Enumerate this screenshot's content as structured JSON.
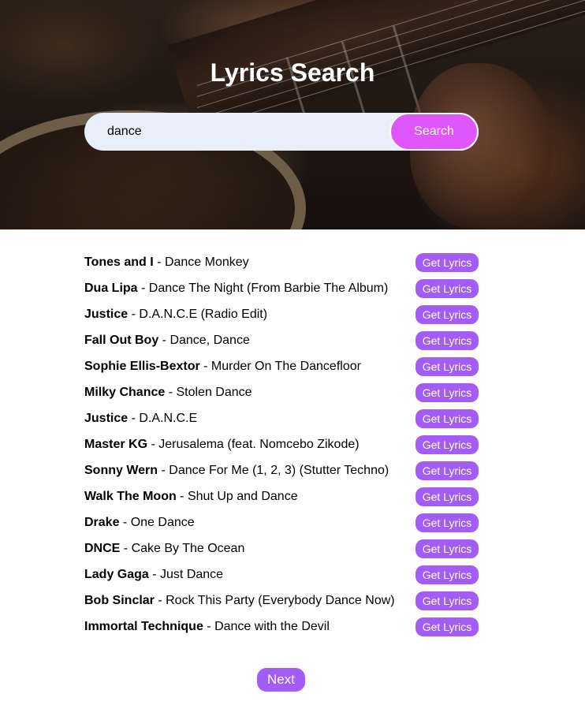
{
  "header": {
    "title": "Lyrics Search"
  },
  "search": {
    "value": "dance",
    "button_label": "Search"
  },
  "results": [
    {
      "artist": "Tones and I",
      "title": "Dance Monkey",
      "button_label": "Get Lyrics"
    },
    {
      "artist": "Dua Lipa",
      "title": "Dance The Night (From Barbie The Album)",
      "button_label": "Get Lyrics"
    },
    {
      "artist": "Justice",
      "title": "D.A.N.C.E (Radio Edit)",
      "button_label": "Get Lyrics"
    },
    {
      "artist": "Fall Out Boy",
      "title": "Dance, Dance",
      "button_label": "Get Lyrics"
    },
    {
      "artist": "Sophie Ellis-Bextor",
      "title": "Murder On The Dancefloor",
      "button_label": "Get Lyrics"
    },
    {
      "artist": "Milky Chance",
      "title": "Stolen Dance",
      "button_label": "Get Lyrics"
    },
    {
      "artist": "Justice",
      "title": "D.A.N.C.E",
      "button_label": "Get Lyrics"
    },
    {
      "artist": "Master KG",
      "title": "Jerusalema (feat. Nomcebo Zikode)",
      "button_label": "Get Lyrics"
    },
    {
      "artist": "Sonny Wern",
      "title": "Dance For Me (1, 2, 3) (Stutter Techno)",
      "button_label": "Get Lyrics"
    },
    {
      "artist": "Walk The Moon",
      "title": "Shut Up and Dance",
      "button_label": "Get Lyrics"
    },
    {
      "artist": "Drake",
      "title": "One Dance",
      "button_label": "Get Lyrics"
    },
    {
      "artist": "DNCE",
      "title": "Cake By The Ocean",
      "button_label": "Get Lyrics"
    },
    {
      "artist": "Lady Gaga",
      "title": "Just Dance",
      "button_label": "Get Lyrics"
    },
    {
      "artist": "Bob Sinclar",
      "title": "Rock This Party (Everybody Dance Now)",
      "button_label": "Get Lyrics"
    },
    {
      "artist": "Immortal Technique",
      "title": "Dance with the Devil",
      "button_label": "Get Lyrics"
    }
  ],
  "pagination": {
    "next_label": "Next"
  },
  "colors": {
    "search_button": "#e056fd",
    "action_button": "#a35cf6",
    "input_background": "#e8eefa"
  }
}
